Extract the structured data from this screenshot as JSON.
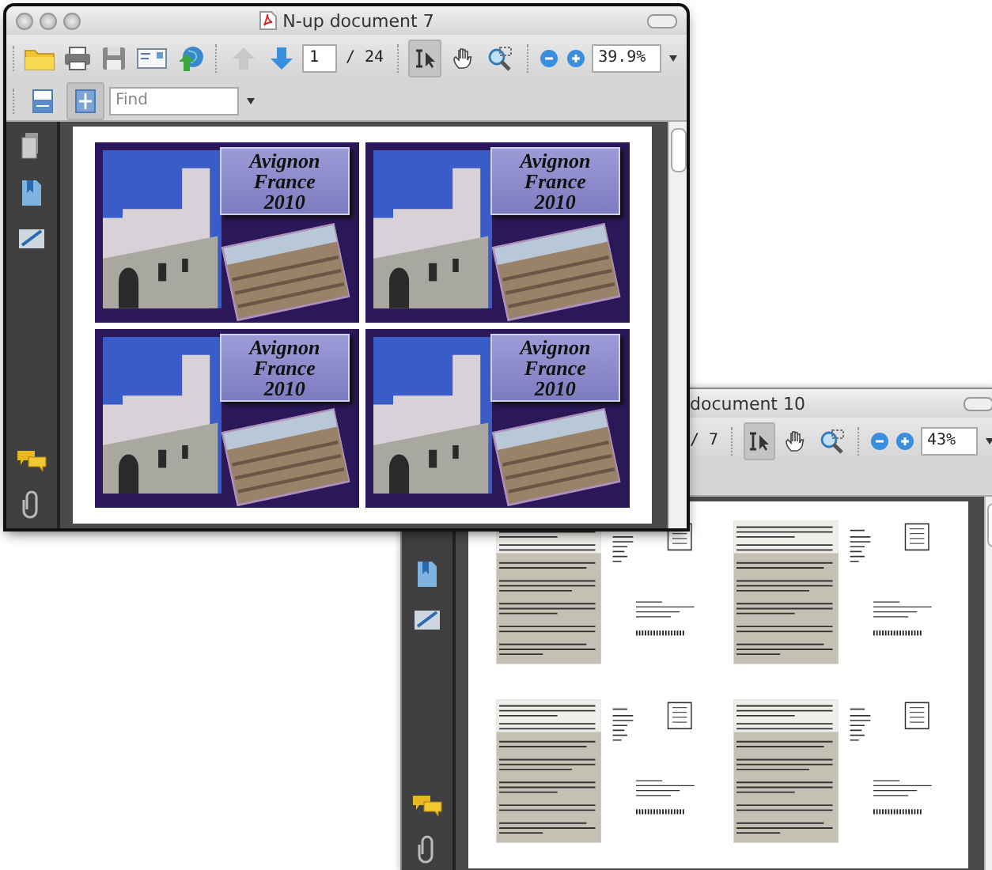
{
  "front_window": {
    "title": "N-up document 7",
    "toolbar": {
      "previous_page_disabled": true,
      "page_number": "1",
      "page_total": "/ 24",
      "zoom": "39.9%",
      "tools": [
        {
          "selected": true
        },
        {
          "selected": false
        },
        {
          "selected": false
        }
      ]
    },
    "view_toolbar": {
      "view_buttons": [
        {
          "selected": false
        },
        {
          "selected": true
        }
      ],
      "find": {
        "placeholder": "Find"
      }
    },
    "tiles": [
      {
        "lines": [
          "Avignon",
          "France",
          "2010"
        ]
      },
      {
        "lines": [
          "Avignon",
          "France",
          "2010"
        ]
      },
      {
        "lines": [
          "Avignon",
          "France",
          "2010"
        ]
      },
      {
        "lines": [
          "Avignon",
          "France",
          "2010"
        ]
      }
    ]
  },
  "back_window": {
    "title": "document 10",
    "toolbar": {
      "page_total": "/ 7",
      "zoom": "43%",
      "tools": [
        {
          "selected": true
        },
        {
          "selected": false
        },
        {
          "selected": false
        }
      ]
    }
  }
}
